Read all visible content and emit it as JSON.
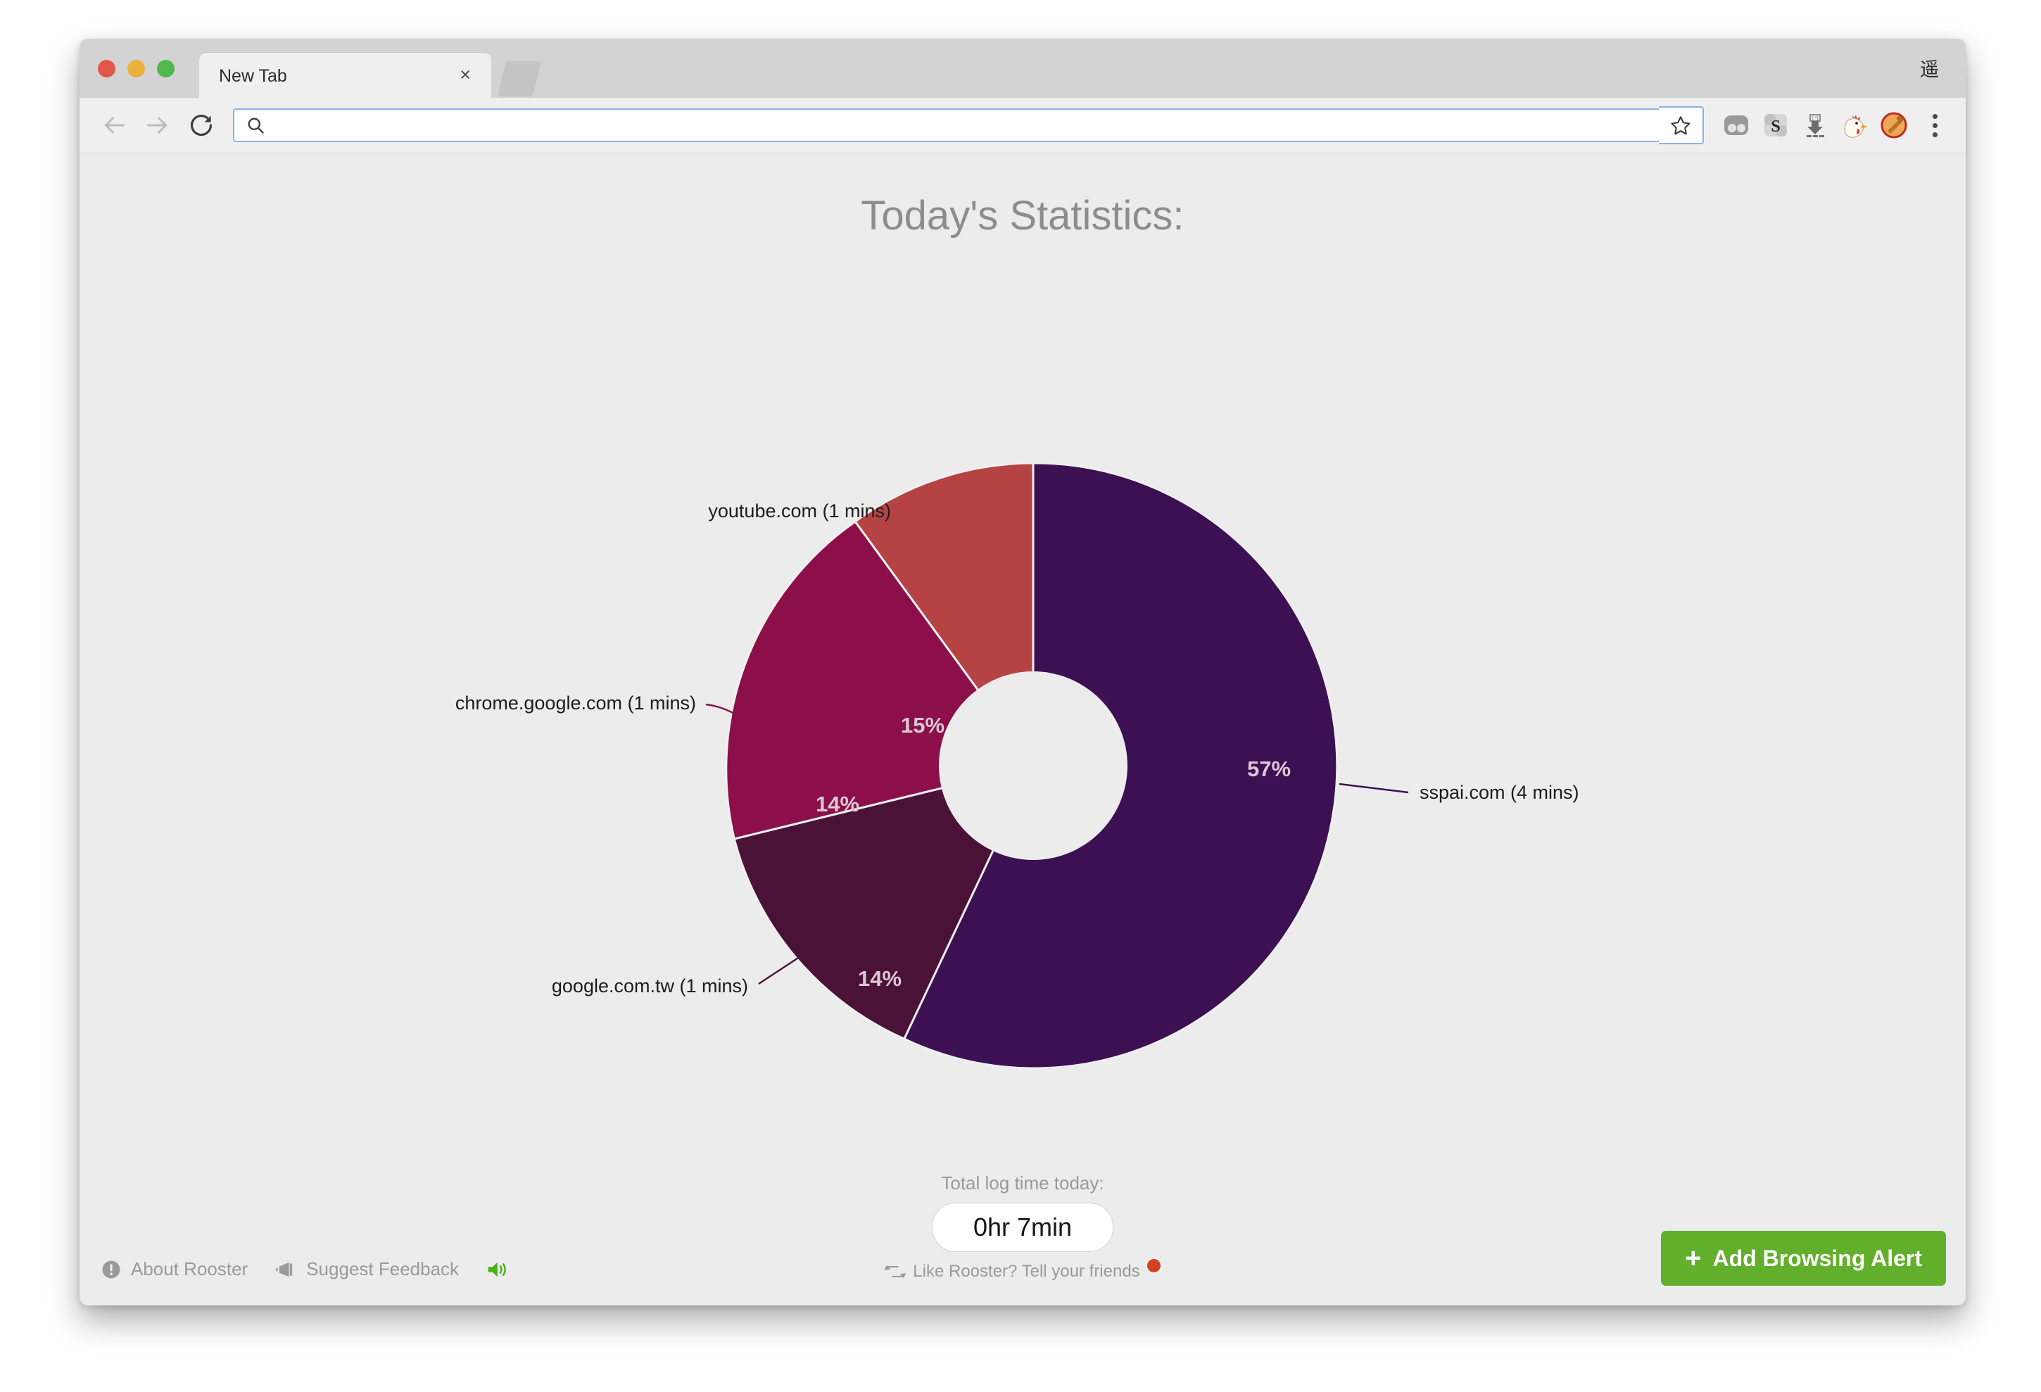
{
  "window": {
    "glyph": "遥",
    "tab": {
      "title": "New Tab",
      "close_label": "×"
    },
    "toolbar": {
      "back_icon": "arrow-left-icon",
      "forward_icon": "arrow-right-icon",
      "reload_icon": "reload-icon",
      "address_value": "",
      "address_placeholder": "",
      "search_icon": "search-icon",
      "bookmark_icon": "star-icon",
      "extensions": [
        "two-dots-extension-icon",
        "s-extension-icon",
        "download-extension-icon",
        "rooster-extension-icon",
        "hammer-extension-icon"
      ],
      "menu_icon": "three-dots-menu-icon"
    }
  },
  "page": {
    "title": "Today's Statistics:",
    "total_label": "Total log time today:",
    "total_value": "0hr 7min",
    "share_text": "Like Rooster? Tell your friends",
    "share_icon": "retweet-icon",
    "share_dot_color": "#cf4520",
    "footer_links": [
      {
        "label": "About Rooster",
        "icon": "info-icon"
      },
      {
        "label": "Suggest Feedback",
        "icon": "megaphone-icon"
      }
    ],
    "sound_icon": "speaker-on-icon",
    "sound_color": "#4caf17",
    "add_alert_button": {
      "label": "Add Browsing Alert",
      "plus": "+",
      "color": "#62af2c"
    }
  },
  "chart_data": {
    "type": "pie",
    "variant": "donut",
    "title": "Today's Statistics:",
    "legend": "callout-labels",
    "total_minutes": 7,
    "categories": [
      "sspai.com",
      "google.com.tw",
      "chrome.google.com",
      "youtube.com"
    ],
    "values": [
      57,
      14,
      14,
      15
    ],
    "minutes": [
      4,
      1,
      1,
      1
    ],
    "value_labels": [
      "57%",
      "14%",
      "14%",
      "15%"
    ],
    "callouts": [
      "sspai.com (4 mins)",
      "google.com.tw (1 mins)",
      "chrome.google.com (1 mins)",
      "youtube.com (1 mins)"
    ],
    "colors": [
      "#3c1053",
      "#4b1238",
      "#8c0f4a",
      "#b54343"
    ],
    "label_color": "#dcc8d4",
    "background": "#ececec",
    "grid": false,
    "start_angle_deg": 0,
    "direction": "clockwise"
  }
}
